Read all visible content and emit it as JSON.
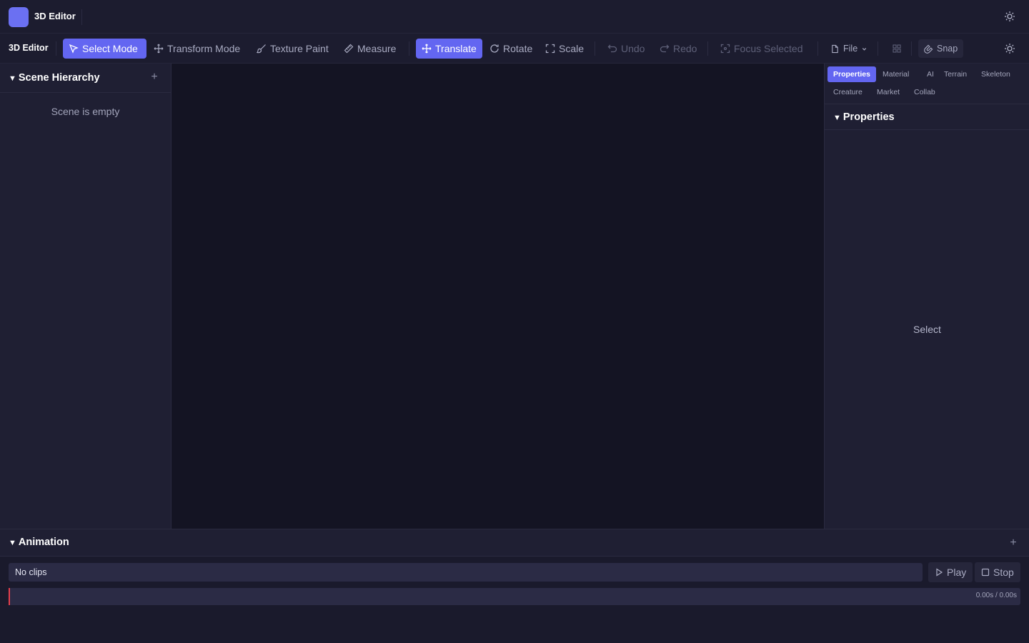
{
  "app": {
    "title": "3D Editor"
  },
  "toolbar": {
    "brand": "3D Editor",
    "modes": [
      {
        "label": "Select Mode",
        "icon": "cursor-arrow-icon",
        "active": true
      },
      {
        "label": "Transform Mode",
        "icon": "move-arrows-icon",
        "active": false
      },
      {
        "label": "Texture Paint",
        "icon": "paintbrush-icon",
        "active": false
      },
      {
        "label": "Measure",
        "icon": "ruler-icon",
        "active": false
      }
    ],
    "transforms": [
      {
        "label": "Translate",
        "icon": "move-arrows-icon",
        "active": true
      },
      {
        "label": "Rotate",
        "icon": "rotate-icon",
        "active": false
      },
      {
        "label": "Scale",
        "icon": "scale-icon",
        "active": false
      }
    ],
    "history": [
      {
        "label": "Undo",
        "icon": "undo-icon",
        "disabled": true
      },
      {
        "label": "Redo",
        "icon": "redo-icon",
        "disabled": true
      }
    ],
    "focus_selected": "Focus Selected",
    "file": "File",
    "snap": "Snap"
  },
  "scene_hierarchy": {
    "title": "Scene Hierarchy",
    "empty_message": "Scene is empty"
  },
  "right_panel": {
    "tabs": [
      {
        "label": "Properties",
        "active": true
      },
      {
        "label": "Material",
        "active": false
      },
      {
        "label": "AI",
        "active": false
      },
      {
        "label": "Terrain",
        "active": false
      },
      {
        "label": "Skeleton",
        "active": false
      },
      {
        "label": "Creature",
        "active": false
      },
      {
        "label": "Market",
        "active": false
      },
      {
        "label": "Collab",
        "active": false
      }
    ],
    "section_title": "Properties",
    "placeholder": "Select"
  },
  "animation": {
    "title": "Animation",
    "clip_select": "No clips",
    "play": "Play",
    "stop": "Stop",
    "time_readout": "0.00s / 0.00s"
  },
  "colors": {
    "accent": "#6366f1",
    "playhead": "#e53e4c",
    "background": "#1a1a2e",
    "viewport": "#141423"
  }
}
